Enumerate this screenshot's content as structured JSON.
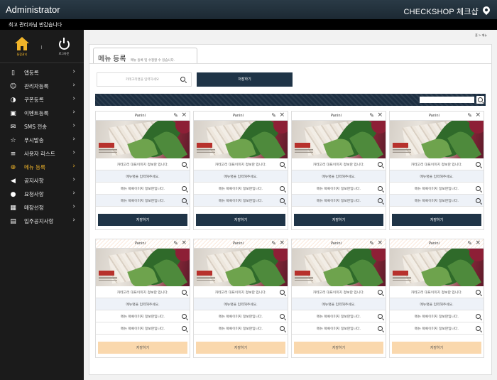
{
  "topbar": {
    "title": "Administrator",
    "brand_en": "CHECKSHOP",
    "brand_ko": "체크샵"
  },
  "notice": "최고 관리자님 반갑습니다",
  "sidebar": {
    "home_label": "통합관리",
    "logout_label": "로그아웃",
    "items": [
      {
        "icon": "mobile-icon",
        "glyph": "▯",
        "label": "앱등록"
      },
      {
        "icon": "user-icon",
        "glyph": "☺",
        "label": "관리자등록"
      },
      {
        "icon": "coupon-icon",
        "glyph": "◑",
        "label": "쿠폰등록"
      },
      {
        "icon": "event-icon",
        "glyph": "▣",
        "label": "이벤트등록"
      },
      {
        "icon": "mail-icon",
        "glyph": "✉",
        "label": "SMS 전송"
      },
      {
        "icon": "star-icon",
        "glyph": "☆",
        "label": "푸시발송"
      },
      {
        "icon": "list-icon",
        "glyph": "≡",
        "label": "사용자 리스트"
      },
      {
        "icon": "plus-circle-icon",
        "glyph": "⊕",
        "label": "메뉴 등록",
        "active": true
      },
      {
        "icon": "megaphone-icon",
        "glyph": "◀",
        "label": "공지사항"
      },
      {
        "icon": "chat-icon",
        "glyph": "●",
        "label": "요청사항"
      },
      {
        "icon": "calendar-icon",
        "glyph": "▦",
        "label": "매장선정"
      },
      {
        "icon": "building-icon",
        "glyph": "▤",
        "label": "입주공지사항"
      }
    ]
  },
  "breadcrumb": "홈 > 메뉴",
  "tab": {
    "title": "메뉴 등록",
    "desc": "메뉴 등록 및 수정할 수 있습니다."
  },
  "search": {
    "placeholder": "카테고리명을 입력하세요"
  },
  "save_top_label": "저장하기",
  "cards_top": [
    {
      "name": "Panini",
      "rows": [
        "카테고리 대표이미지 정보란 입니다.",
        "메뉴명을 입력해주세요.",
        "메뉴 목록이미지 정보란입니다.",
        "메뉴 목록이미지 정보란입니다."
      ],
      "button": "저장하기"
    },
    {
      "name": "Panini",
      "rows": [
        "카테고리 대표이미지 정보란 입니다.",
        "메뉴명을 입력해주세요.",
        "메뉴 목록이미지 정보란입니다.",
        "메뉴 목록이미지 정보란입니다."
      ],
      "button": "저장하기"
    },
    {
      "name": "Panini",
      "rows": [
        "카테고리 대표이미지 정보란 입니다.",
        "메뉴명을 입력해주세요.",
        "메뉴 목록이미지 정보란입니다.",
        "메뉴 목록이미지 정보란입니다."
      ],
      "button": "저장하기"
    },
    {
      "name": "Panini",
      "rows": [
        "카테고리 대표이미지 정보란 입니다.",
        "메뉴명을 입력해주세요.",
        "메뉴 목록이미지 정보란입니다.",
        "메뉴 목록이미지 정보란입니다."
      ],
      "button": "저장하기"
    }
  ],
  "cards_bottom": [
    {
      "name": "Panini",
      "rows": [
        "카테고리 대표이미지 정보란 입니다.",
        "메뉴명을 입력해주세요.",
        "메뉴 목록이미지 정보란입니다.",
        "메뉴 목록이미지 정보란입니다."
      ],
      "button": "저장하기"
    },
    {
      "name": "Panini",
      "rows": [
        "카테고리 대표이미지 정보란 입니다.",
        "메뉴명을 입력해주세요.",
        "메뉴 목록이미지 정보란입니다.",
        "메뉴 목록이미지 정보란입니다."
      ],
      "button": "저장하기"
    },
    {
      "name": "Panini",
      "rows": [
        "카테고리 대표이미지 정보란 입니다.",
        "메뉴명을 입력해주세요.",
        "메뉴 목록이미지 정보란입니다.",
        "메뉴 목록이미지 정보란입니다."
      ],
      "button": "저장하기"
    },
    {
      "name": "Panini",
      "rows": [
        "카테고리 대표이미지 정보란 입니다.",
        "메뉴명을 입력해주세요.",
        "메뉴 목록이미지 정보란입니다.",
        "메뉴 목록이미지 정보란입니다."
      ],
      "button": "저장하기"
    }
  ],
  "colors": {
    "navy": "#1f3447",
    "accent": "#f0b429",
    "peach": "#fad8ad"
  }
}
